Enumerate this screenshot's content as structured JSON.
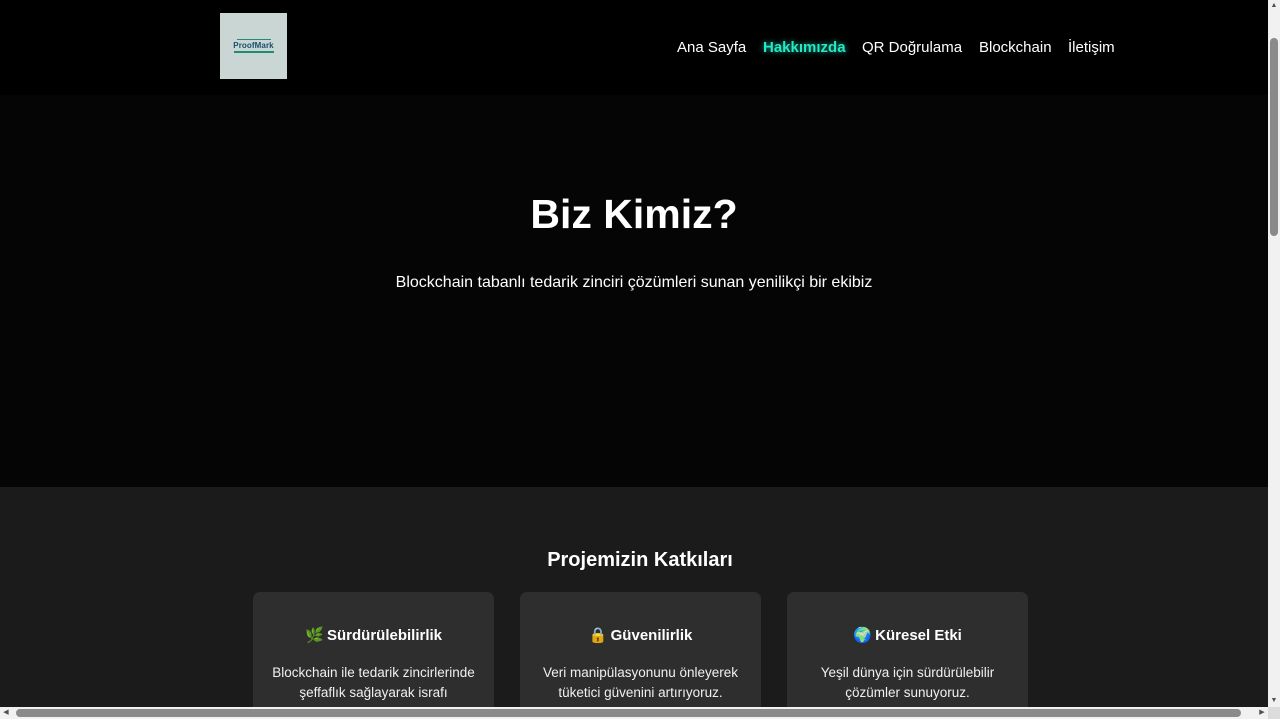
{
  "header": {
    "logo_text": "ProofMark",
    "nav": [
      {
        "label": "Ana Sayfa",
        "active": false
      },
      {
        "label": "Hakkımızda",
        "active": true
      },
      {
        "label": "QR Doğrulama",
        "active": false
      },
      {
        "label": "Blockchain",
        "active": false
      },
      {
        "label": "İletişim",
        "active": false
      }
    ]
  },
  "hero": {
    "title": "Biz Kimiz?",
    "subtitle": "Blockchain tabanlı tedarik zinciri çözümleri sunan yenilikçi bir ekibiz"
  },
  "contributions": {
    "title": "Projemizin Katkıları",
    "cards": [
      {
        "icon": "🌿",
        "icon_name": "leaf-icon",
        "title": "Sürdürülebilirlik",
        "description": "Blockchain ile tedarik zincirlerinde şeffaflık sağlayarak israfı"
      },
      {
        "icon": "🔒",
        "icon_name": "lock-icon",
        "title": "Güvenilirlik",
        "description": "Veri manipülasyonunu önleyerek tüketici güvenini artırıyoruz."
      },
      {
        "icon": "🌍",
        "icon_name": "globe-icon",
        "title": "Küresel Etki",
        "description": "Yeşil dünya için sürdürülebilir çözümler sunuyoruz."
      }
    ]
  },
  "colors": {
    "accent": "#25e8c4",
    "background": "#000000",
    "section_background": "#1b1b1b",
    "card_background": "#2e2e2e"
  },
  "scrollbar": {
    "up_arrow": "▲",
    "down_arrow": "▼",
    "left_arrow": "◀",
    "right_arrow": "▶"
  }
}
